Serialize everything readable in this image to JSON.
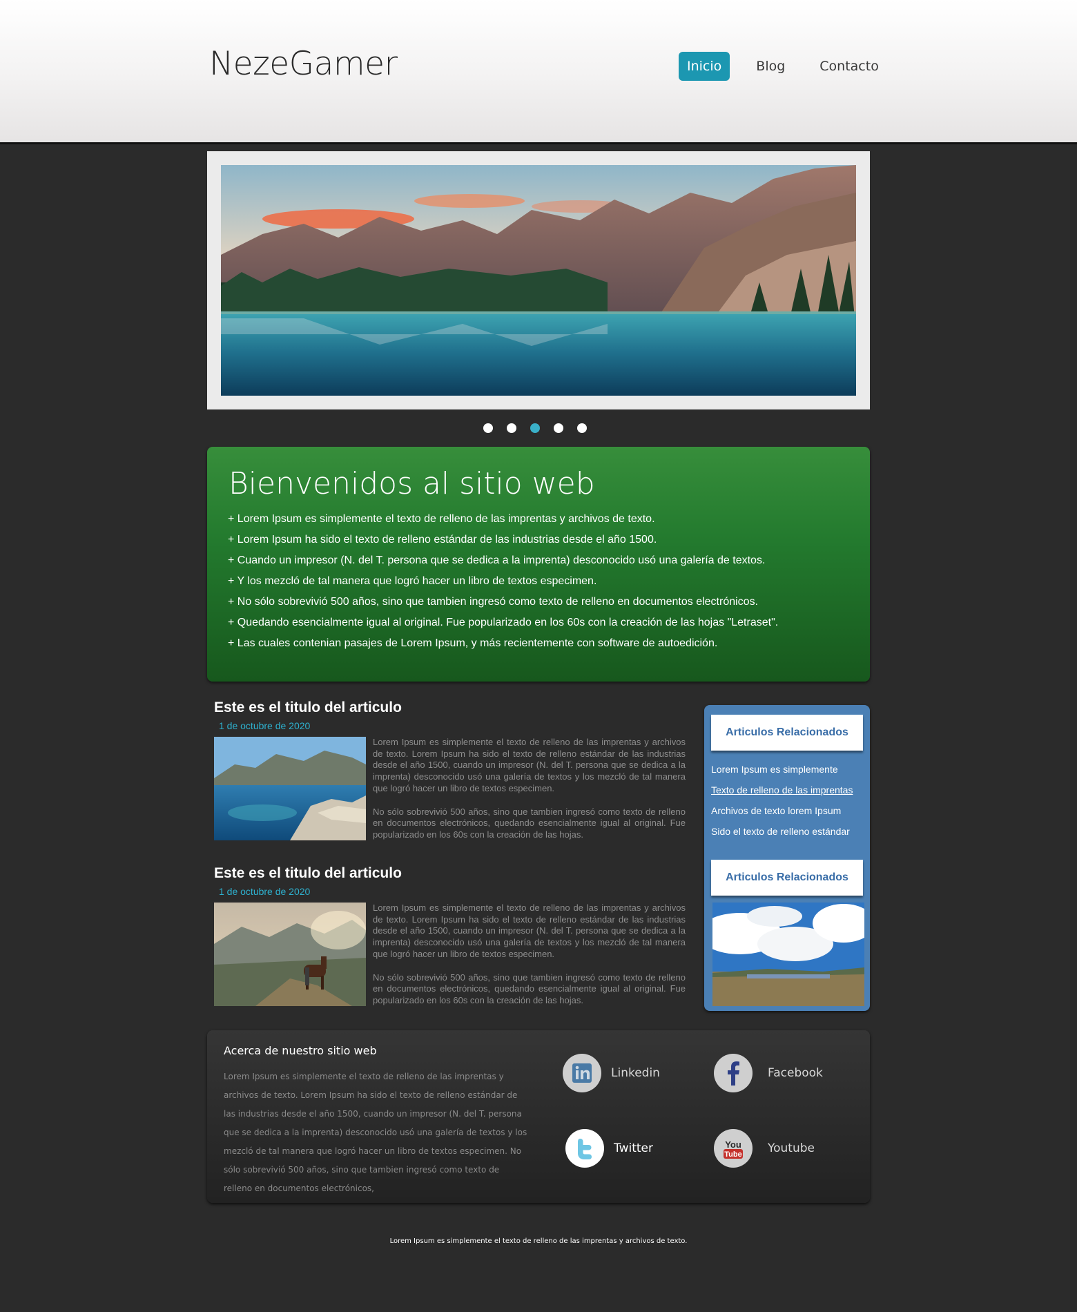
{
  "header": {
    "brand": "NezeGamer",
    "nav": [
      "Inicio",
      "Blog",
      "Contacto"
    ]
  },
  "slider": {
    "image": "mountain-lake-landscape",
    "dots_count": 5,
    "active_dot": 3
  },
  "welcome": {
    "title": "Bienvenidos al sitio web",
    "items": [
      "+ Lorem Ipsum es simplemente el texto de relleno de las imprentas y archivos de texto.",
      "+ Lorem Ipsum ha sido el texto de relleno estándar de las industrias desde el año 1500.",
      "+ Cuando un impresor (N. del T. persona que se dedica a la imprenta) desconocido usó una galería de textos.",
      "+ Y los mezcló de tal manera que logró hacer un libro de textos especimen.",
      "+ No sólo sobrevivió 500 años, sino que tambien ingresó como texto de relleno en documentos electrónicos.",
      "+ Quedando esencialmente igual al original. Fue popularizado en los 60s con la creación de las hojas \"Letraset\".",
      "+ Las cuales contenian pasajes de Lorem Ipsum, y más recientemente con software de autoedición."
    ]
  },
  "articles": [
    {
      "title": "Este es el titulo del articulo",
      "date": "1 de octubre de 2020",
      "image": "coastal-bay",
      "p1": "Lorem Ipsum es simplemente el texto de relleno de las imprentas y archivos de texto. Lorem Ipsum ha sido el texto de relleno estándar de las industrias desde el año 1500, cuando un impresor (N. del T. persona que se dedica a la imprenta) desconocido usó una galería de textos y los mezcló de tal manera que logró hacer un libro de textos especimen.",
      "p2": "No sólo sobrevivió 500 años, sino que tambien ingresó como texto de relleno en documentos electrónicos, quedando esencialmente igual al original. Fue popularizado en los 60s con la creación de las hojas."
    },
    {
      "title": "Este es el titulo del articulo",
      "date": "1 de octubre de 2020",
      "image": "rider-and-horse-in-mountains",
      "p1": "Lorem Ipsum es simplemente el texto de relleno de las imprentas y archivos de texto. Lorem Ipsum ha sido el texto de relleno estándar de las industrias desde el año 1500, cuando un impresor (N. del T. persona que se dedica a la imprenta) desconocido usó una galería de textos y los mezcló de tal manera que logró hacer un libro de textos especimen.",
      "p2": "No sólo sobrevivió 500 años, sino que tambien ingresó como texto de relleno en documentos electrónicos, quedando esencialmente igual al original. Fue popularizado en los 60s con la creación de las hojas."
    }
  ],
  "sidebar": {
    "heading1": "Articulos Relacionados",
    "links": [
      "Lorem Ipsum es simplemente",
      "Texto de relleno de las imprentas",
      "Archivos de texto lorem Ipsum",
      "Sido el texto de relleno estándar"
    ],
    "heading2": "Articulos Relacionados",
    "image": "cloudy-sky-over-field"
  },
  "footer": {
    "about_title": "Acerca de nuestro sitio web",
    "about_text": "Lorem Ipsum es simplemente el texto de relleno de las imprentas y archivos de texto. Lorem Ipsum ha sido el texto de relleno estándar de las industrias desde el año 1500, cuando un impresor (N. del T. persona que se dedica a la imprenta) desconocido usó una galería de textos y los mezcló de tal manera que logró hacer un libro de textos especimen. No sólo sobrevivió 500 años, sino que tambien ingresó como texto de relleno en documentos electrónicos,",
    "social": [
      {
        "name": "Linkedin",
        "icon": "linkedin-icon"
      },
      {
        "name": "Facebook",
        "icon": "facebook-icon"
      },
      {
        "name": "Twitter",
        "icon": "twitter-icon"
      },
      {
        "name": "Youtube",
        "icon": "youtube-icon"
      }
    ],
    "copyright": "Lorem Ipsum es simplemente el texto de relleno de las imprentas y archivos de texto."
  },
  "colors": {
    "nav_active": "#1c97b1",
    "welcome_green": "#237a2e",
    "sidebar_blue": "#4b80b5",
    "date_cyan": "#2eb1cf",
    "background": "#2b2b2b"
  }
}
